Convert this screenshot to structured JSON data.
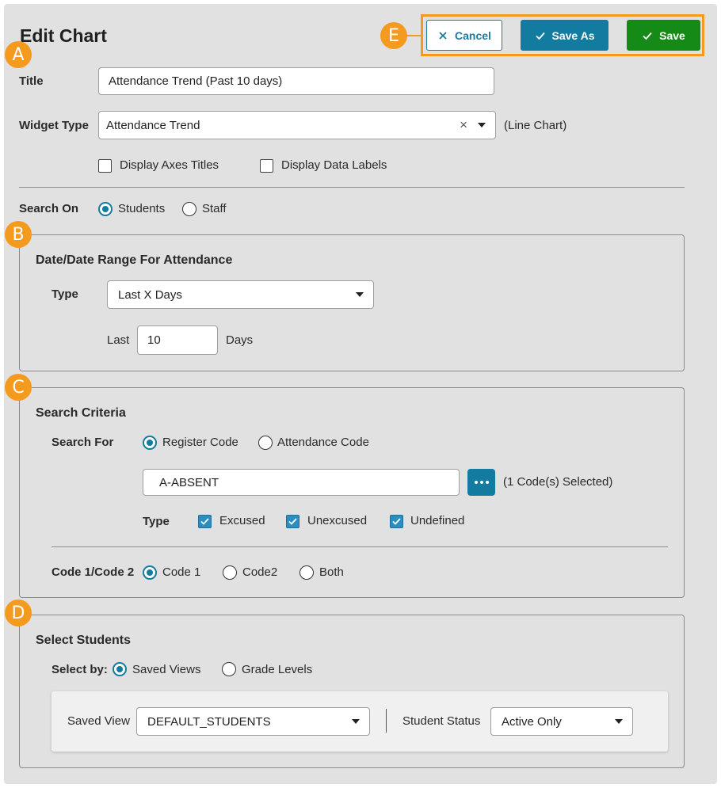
{
  "header": {
    "title": "Edit Chart",
    "cancel_label": "Cancel",
    "save_as_label": "Save As",
    "save_label": "Save"
  },
  "callouts": {
    "a": "A",
    "b": "B",
    "c": "C",
    "d": "D",
    "e": "E"
  },
  "general": {
    "title_label": "Title",
    "title_value": "Attendance Trend (Past 10 days)",
    "widget_type_label": "Widget Type",
    "widget_type_value": "Attendance Trend",
    "widget_type_note": "(Line Chart)",
    "display_axes_titles": {
      "label": "Display Axes Titles",
      "checked": false
    },
    "display_data_labels": {
      "label": "Display Data Labels",
      "checked": false
    }
  },
  "search_on": {
    "label": "Search On",
    "options": [
      {
        "label": "Students",
        "selected": true
      },
      {
        "label": "Staff",
        "selected": false
      }
    ]
  },
  "date_range": {
    "heading": "Date/Date Range For Attendance",
    "type_label": "Type",
    "type_value": "Last X Days",
    "last_label": "Last",
    "last_value": "10",
    "days_label": "Days"
  },
  "search_criteria": {
    "heading": "Search Criteria",
    "search_for_label": "Search For",
    "search_for_options": [
      {
        "label": "Register Code",
        "selected": true
      },
      {
        "label": "Attendance Code",
        "selected": false
      }
    ],
    "code_value": "A-ABSENT",
    "code_count": "(1 Code(s) Selected)",
    "type_label": "Type",
    "type_options": [
      {
        "label": "Excused",
        "checked": true
      },
      {
        "label": "Unexcused",
        "checked": true
      },
      {
        "label": "Undefined",
        "checked": true
      }
    ],
    "code12_label": "Code 1/Code 2",
    "code12_options": [
      {
        "label": "Code 1",
        "selected": true
      },
      {
        "label": "Code2",
        "selected": false
      },
      {
        "label": "Both",
        "selected": false
      }
    ]
  },
  "select_students": {
    "heading": "Select Students",
    "select_by_label": "Select by:",
    "select_by_options": [
      {
        "label": "Saved Views",
        "selected": true
      },
      {
        "label": "Grade Levels",
        "selected": false
      }
    ],
    "saved_view_label": "Saved View",
    "saved_view_value": "DEFAULT_STUDENTS",
    "student_status_label": "Student Status",
    "student_status_value": "Active Only"
  },
  "colors": {
    "panel_bg": "#e1e1e1",
    "accent_blue": "#137aa0",
    "save_green": "#168a16",
    "callout_orange": "#f49a1e"
  }
}
